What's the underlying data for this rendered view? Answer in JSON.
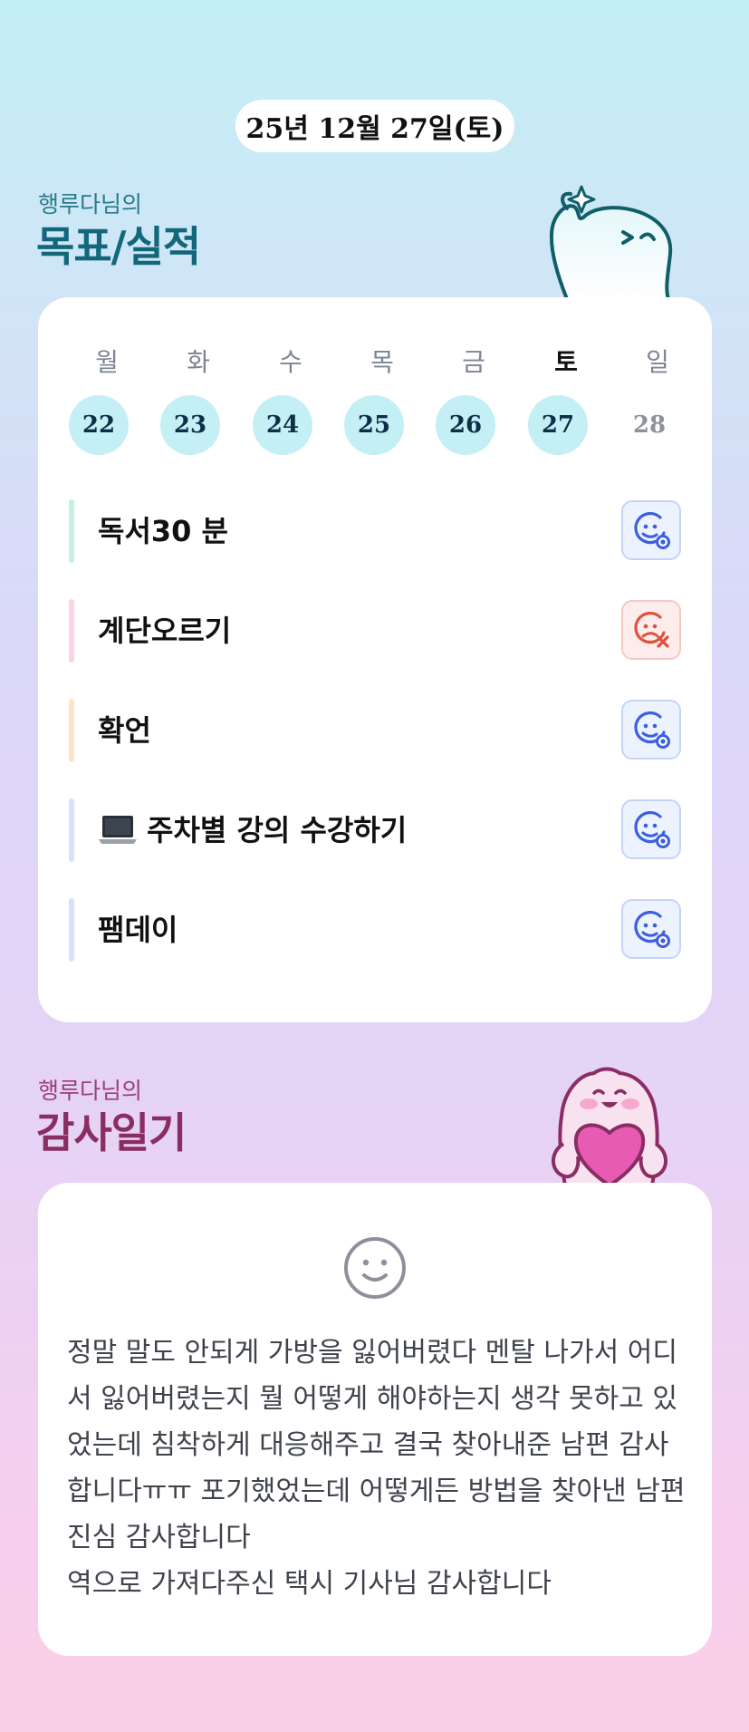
{
  "header": {
    "date": "25년 12월 27일(토)"
  },
  "goals_section": {
    "owner_label": "행루다님의",
    "title": "목표/실적",
    "weekdays": [
      {
        "label": "월",
        "today": false
      },
      {
        "label": "화",
        "today": false
      },
      {
        "label": "수",
        "today": false
      },
      {
        "label": "목",
        "today": false
      },
      {
        "label": "금",
        "today": false
      },
      {
        "label": "토",
        "today": true
      },
      {
        "label": "일",
        "today": false
      }
    ],
    "dates": [
      {
        "label": "22",
        "active": true
      },
      {
        "label": "23",
        "active": true
      },
      {
        "label": "24",
        "active": true
      },
      {
        "label": "25",
        "active": true
      },
      {
        "label": "26",
        "active": true
      },
      {
        "label": "27",
        "active": true
      },
      {
        "label": "28",
        "active": false
      }
    ],
    "tasks": [
      {
        "label": "독서30 분",
        "bar_color": "#c5f0df",
        "status": "done",
        "status_icon": "happy-face-check-icon"
      },
      {
        "label": "계단오르기",
        "bar_color": "#fbd3e6",
        "status": "failed",
        "status_icon": "sad-face-x-icon"
      },
      {
        "label": "확언",
        "bar_color": "#fde3c6",
        "status": "done",
        "status_icon": "happy-face-check-icon"
      },
      {
        "label": "주차별 강의 수강하기",
        "bar_color": "#d6e2fb",
        "status": "done",
        "status_icon": "happy-face-check-icon",
        "prefix_icon": "laptop-icon"
      },
      {
        "label": "팸데이",
        "bar_color": "#d6e2fb",
        "status": "done",
        "status_icon": "happy-face-check-icon"
      }
    ]
  },
  "gratitude_section": {
    "owner_label": "행루다님의",
    "title": "감사일기",
    "mood_icon": "smile-face-icon",
    "text": "정말 말도 안되게 가방을 잃어버렸다 멘탈 나가서 어디서 잃어버렸는지 뭘 어떻게 해야하는지 생각 못하고 있었는데 침착하게 대응해주고 결국 찾아내준 남편 감사합니다ㅠㅠ 포기했었는데 어떻게든 방법을 찾아낸 남편 진심 감사합니다\n역으로 가져다주신 택시 기사님 감사합니다"
  },
  "colors": {
    "date_circle": "#c4eff4",
    "ok_icon": "#3b5fe0",
    "fail_icon": "#e0503c",
    "goals_title": "#13677b",
    "gratitude_title": "#8a2d63"
  }
}
